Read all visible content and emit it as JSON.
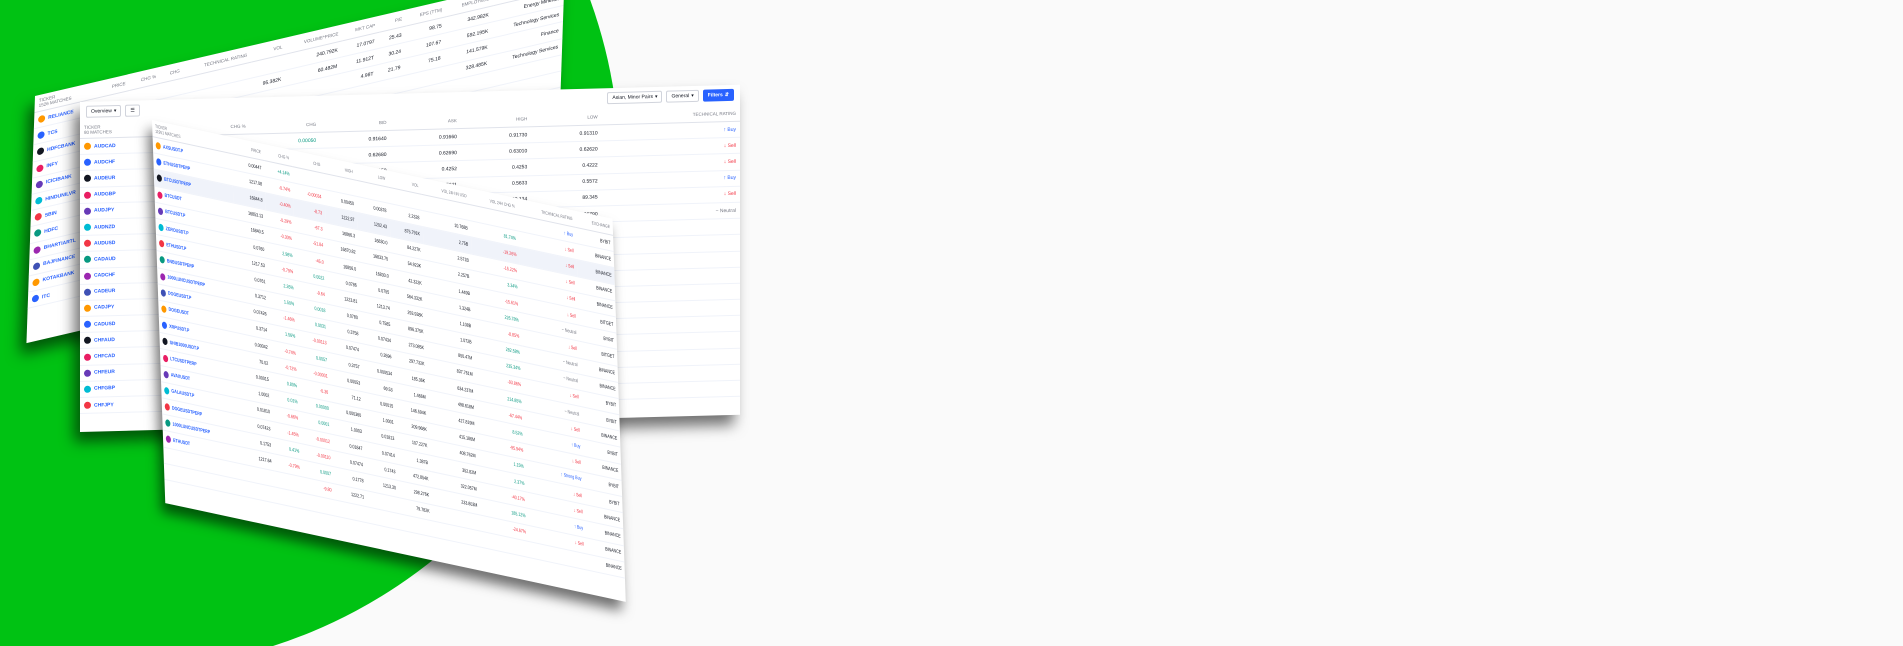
{
  "colors": {
    "green_bg": "#00c213",
    "accent": "#2962ff",
    "positive": "#089981",
    "negative": "#f23645"
  },
  "sheet_stocks": {
    "columns": [
      "TICKER",
      "PRICE",
      "CHG %",
      "CHG",
      "TECHNICAL RATING",
      "VOL",
      "VOLUME*PRICE",
      "MKT CAP",
      "P/E",
      "EPS (TTM)",
      "EMPLOYEES",
      "SECTOR"
    ],
    "ticker_sub": "1526 MATCHES",
    "rows": [
      {
        "symbol": "RELIANCE",
        "cells": [
          "",
          "",
          "",
          "",
          "",
          "240.792K",
          "17.0797",
          "25.43",
          "98.75",
          "342.982K",
          "Energy Minerals"
        ]
      },
      {
        "symbol": "TCS",
        "cells": [
          "",
          "",
          "",
          "",
          "95.382K",
          "60.482M",
          "11.912T",
          "30.24",
          "107.67",
          "592.195K",
          "Technology Services"
        ]
      },
      {
        "symbol": "HDFCBANK",
        "cells": [
          "",
          "",
          "",
          "",
          "",
          "",
          "4.98T",
          "21.79",
          "75.18",
          "141.579K",
          "Finance"
        ]
      },
      {
        "symbol": "INFY",
        "cells": [
          "",
          "",
          "",
          "",
          "",
          "",
          "",
          "",
          "",
          "328.485K",
          "Technology Services"
        ]
      },
      {
        "symbol": "ICICIBANK",
        "cells": [
          "",
          "",
          "",
          "",
          "",
          "",
          "",
          "",
          "",
          "",
          ""
        ]
      },
      {
        "symbol": "HINDUNILVR",
        "cells": [
          "",
          "",
          "",
          "",
          "",
          "",
          "",
          "",
          "",
          "",
          ""
        ]
      },
      {
        "symbol": "SBIN",
        "cells": [
          "",
          "",
          "",
          "",
          "",
          "",
          "",
          "",
          "",
          "",
          ""
        ]
      },
      {
        "symbol": "HDFC",
        "cells": [
          "",
          "",
          "",
          "",
          "",
          "",
          "",
          "",
          "",
          "",
          ""
        ]
      },
      {
        "symbol": "BHARTIARTL",
        "cells": [
          "",
          "",
          "",
          "",
          "",
          "",
          "",
          "",
          "",
          "",
          ""
        ]
      },
      {
        "symbol": "BAJFINANCE",
        "cells": [
          "",
          "",
          "",
          "",
          "",
          "",
          "",
          "",
          "",
          "",
          ""
        ]
      },
      {
        "symbol": "KOTAKBANK",
        "cells": [
          "",
          "",
          "",
          "",
          "",
          "",
          "",
          "",
          "",
          "",
          ""
        ]
      },
      {
        "symbol": "ITC",
        "cells": [
          "",
          "",
          "",
          "",
          "",
          "",
          "",
          "",
          "",
          "",
          ""
        ]
      }
    ]
  },
  "sheet_forex": {
    "toolbar": {
      "overview": "Overview",
      "majors": "Asian, Minor Pairs",
      "general": "General",
      "filters": "Filters"
    },
    "columns": [
      "TICKER",
      "CHG %",
      "CHG",
      "BID",
      "ASK",
      "HIGH",
      "LOW",
      "TECHNICAL RATING"
    ],
    "ticker_sub": "80 MATCHES",
    "rows": [
      {
        "symbol": "AUDCAD",
        "cells": [
          "",
          "0.00050",
          "0.91640",
          "0.91660",
          "0.91730",
          "0.91310",
          "Buy"
        ]
      },
      {
        "symbol": "AUDCHF",
        "cells": [
          "",
          "",
          "0.62680",
          "0.62690",
          "0.63010",
          "0.62620",
          "Sell"
        ]
      },
      {
        "symbol": "AUDEUR",
        "cells": [
          "",
          "",
          "0.4250",
          "0.4252",
          "0.4253",
          "0.4222",
          "Sell"
        ]
      },
      {
        "symbol": "AUDGBP",
        "cells": [
          "",
          "",
          "",
          "0.5611",
          "0.5633",
          "0.5572",
          "Buy"
        ]
      },
      {
        "symbol": "AUDJPY",
        "cells": [
          "",
          "",
          "",
          "",
          "90.134",
          "89.345",
          "Sell"
        ]
      },
      {
        "symbol": "AUDNZD",
        "cells": [
          "",
          "",
          "",
          "",
          "",
          "1.06790",
          "Neutral"
        ]
      },
      {
        "symbol": "AUDUSD",
        "cells": [
          "",
          "",
          "",
          "",
          "",
          "",
          ""
        ]
      },
      {
        "symbol": "CADAUD",
        "cells": [
          "",
          "",
          "",
          "",
          "",
          "",
          ""
        ]
      },
      {
        "symbol": "CADCHF",
        "cells": [
          "",
          "",
          "",
          "",
          "",
          "",
          ""
        ]
      },
      {
        "symbol": "CADEUR",
        "cells": [
          "",
          "",
          "",
          "",
          "",
          "",
          ""
        ]
      },
      {
        "symbol": "CADJPY",
        "cells": [
          "",
          "",
          "",
          "",
          "",
          "",
          ""
        ]
      },
      {
        "symbol": "CADUSD",
        "cells": [
          "",
          "",
          "",
          "",
          "",
          "",
          ""
        ]
      },
      {
        "symbol": "CHFAUD",
        "cells": [
          "",
          "",
          "",
          "",
          "",
          "",
          ""
        ]
      },
      {
        "symbol": "CHFCAD",
        "cells": [
          "",
          "",
          "",
          "",
          "",
          "",
          ""
        ]
      },
      {
        "symbol": "CHFEUR",
        "cells": [
          "",
          "",
          "",
          "",
          "",
          "",
          ""
        ]
      },
      {
        "symbol": "CHFGBP",
        "cells": [
          "",
          "",
          "",
          "",
          "",
          "",
          ""
        ]
      },
      {
        "symbol": "CHFJPY",
        "cells": [
          "",
          "",
          "",
          "",
          "",
          "",
          ""
        ]
      }
    ]
  },
  "sheet_crypto": {
    "columns": [
      "TICKER",
      "PRICE",
      "CHG %",
      "CHG",
      "HIGH",
      "LOW",
      "VOL",
      "VOL 24H IN USD",
      "VOL 24H CHG %",
      "TECHNICAL RATING",
      "EXCHANGE"
    ],
    "ticker_sub": "11951 MATCHES",
    "rows": [
      {
        "symbol": "AXSUSDT.P",
        "cells": [
          "0.00447",
          "+4.14%",
          "",
          "",
          "",
          "",
          "",
          "",
          "Buy",
          "BYBIT"
        ],
        "chg": "pos"
      },
      {
        "symbol": "ETHUSDTPERP",
        "cells": [
          "1217.08",
          "-0.74%",
          "-0.00034",
          "0.00450",
          "0.00378",
          "2.2328",
          "10.768B",
          "81.74%",
          "Sell",
          "BINANCE"
        ],
        "chg": "neg"
      },
      {
        "symbol": "BTCUSDTPERP",
        "cells": [
          "16844.8",
          "-0.40%",
          "-8.73",
          "1222.97",
          "1202.43",
          "875.791K",
          "2.75B",
          "-19.26%",
          "Sell",
          "BINANCE"
        ],
        "chg": "neg",
        "hl": true
      },
      {
        "symbol": "BTCUSDT",
        "cells": [
          "16853.13",
          "-0.29%",
          "-67.3",
          "16866.3",
          "16830.0",
          "84.227K",
          "2.571B",
          "-15.22%",
          "Sell",
          "BINANCE"
        ],
        "chg": "neg"
      },
      {
        "symbol": "BTCUSDT.P",
        "cells": [
          "16840.5",
          "-0.30%",
          "-51.84",
          "16870.82",
          "16833.75",
          "54.923K",
          "2.257B",
          "3.34%",
          "Sell",
          "BINANCE"
        ],
        "chg": "neg"
      },
      {
        "symbol": "ZEROUSDT.P",
        "cells": [
          "0.0760",
          "2.98%",
          "-45.0",
          "16856.0",
          "16830.0",
          "42.322K",
          "1.449B",
          "-15.61%",
          "Sell",
          "BITGET"
        ],
        "chg": "pos"
      },
      {
        "symbol": "ETHUSDT.P",
        "cells": [
          "1217.53",
          "-0.79%",
          "0.0022",
          "0.0786",
          "0.0755",
          "564.332K",
          "1.324B",
          "226.78%",
          "Neutral",
          "BYBIT"
        ],
        "chg": "neg"
      },
      {
        "symbol": "BNBUSDTPERP",
        "cells": [
          "0.0761",
          "2.26%",
          "-9.64",
          "1223.81",
          "1213.74",
          "293.938K",
          "1.108B",
          "-8.85%",
          "Sell",
          "BITGET"
        ],
        "chg": "pos"
      },
      {
        "symbol": "1000LUNCUSDTPERP",
        "cells": [
          "0.3712",
          "1.50%",
          "0.0018",
          "0.0780",
          "0.7585",
          "896.375K",
          "1.072B",
          "282.58%",
          "Neutral",
          "BINANCE"
        ],
        "chg": "pos"
      },
      {
        "symbol": "DOGEUSDT.P",
        "cells": [
          "0.07426",
          "-1.46%",
          "0.0031",
          "0.3758",
          "0.07434",
          "273.085K",
          "850.47M",
          "235.34%",
          "Neutral",
          "BINANCE"
        ],
        "chg": "neg"
      },
      {
        "symbol": "DOGEUSDT",
        "cells": [
          "0.3714",
          "1.56%",
          "-0.00113",
          "0.07474",
          "0.3596",
          "297.732K",
          "837.761M",
          "-93.86%",
          "Sell",
          "BYBIT"
        ],
        "chg": "pos"
      },
      {
        "symbol": "XRPUSDT.P",
        "cells": [
          "0.00042",
          "-0.74%",
          "0.0057",
          "0.3757",
          "0.000534",
          "185.36K",
          "634.237M",
          "214.85%",
          "Neutral",
          "BYBIT"
        ],
        "chg": "neg"
      },
      {
        "symbol": "SHIB1000USDT.P",
        "cells": [
          "70.02",
          "-0.72%",
          "-0.00001",
          "0.00053",
          "69.53",
          "1.466M",
          "498.618M",
          "-67.44%",
          "Sell",
          "BINANCE"
        ],
        "chg": "neg"
      },
      {
        "symbol": "LTCUSDTPERP",
        "cells": [
          "0.00015",
          "0.80%",
          "-0.36",
          "71.12",
          "0.00015",
          "146.594K",
          "427.819M",
          "8.52%",
          "Buy",
          "BYBIT"
        ],
        "chg": "pos"
      },
      {
        "symbol": "AVAXUSDT",
        "cells": [
          "1.0002",
          "0.01%",
          "0.00000",
          "0.000360",
          "1.0001",
          "209.968K",
          "415.186M",
          "-95.94%",
          "Sell",
          "BINANCE"
        ],
        "chg": "pos"
      },
      {
        "symbol": "GALAUSDT.P",
        "cells": [
          "0.01810",
          "-0.66%",
          "0.0001",
          "1.0003",
          "0.01813",
          "107.227K",
          "408.762M",
          "1.15%",
          "Strong Buy",
          "BYBIT"
        ],
        "chg": "neg"
      },
      {
        "symbol": "DOGEUSDTPERP",
        "cells": [
          "0.07423",
          "-1.45%",
          "-0.00012",
          "0.01847",
          "0.07414",
          "1.387B",
          "352.82M",
          "2.37%",
          "Sell",
          "BYBIT"
        ],
        "chg": "neg"
      },
      {
        "symbol": "1000LUNCUSDTPERP",
        "cells": [
          "0.1753",
          "0.41%",
          "-0.00110",
          "0.07474",
          "0.1743",
          "472.854K",
          "322.057M",
          "-40.17%",
          "Sell",
          "BINANCE"
        ],
        "chg": "pos"
      },
      {
        "symbol": "ETHUSDT",
        "cells": [
          "1217.64",
          "-0.79%",
          "0.0007",
          "0.1778",
          "1213.30",
          "298.276K",
          "233.803M",
          "185.12%",
          "Buy",
          "BINANCE"
        ],
        "chg": "neg"
      },
      {
        "symbol": "",
        "cells": [
          "",
          "",
          "-9.80",
          "1222.71",
          "",
          "79.782K",
          "",
          "-24.67%",
          "Sell",
          "BINANCE"
        ],
        "chg": "neg"
      },
      {
        "symbol": "",
        "cells": [
          "",
          "",
          "",
          "",
          "",
          "",
          "",
          "",
          "",
          "BINANCE"
        ],
        "chg": "neg"
      }
    ]
  }
}
